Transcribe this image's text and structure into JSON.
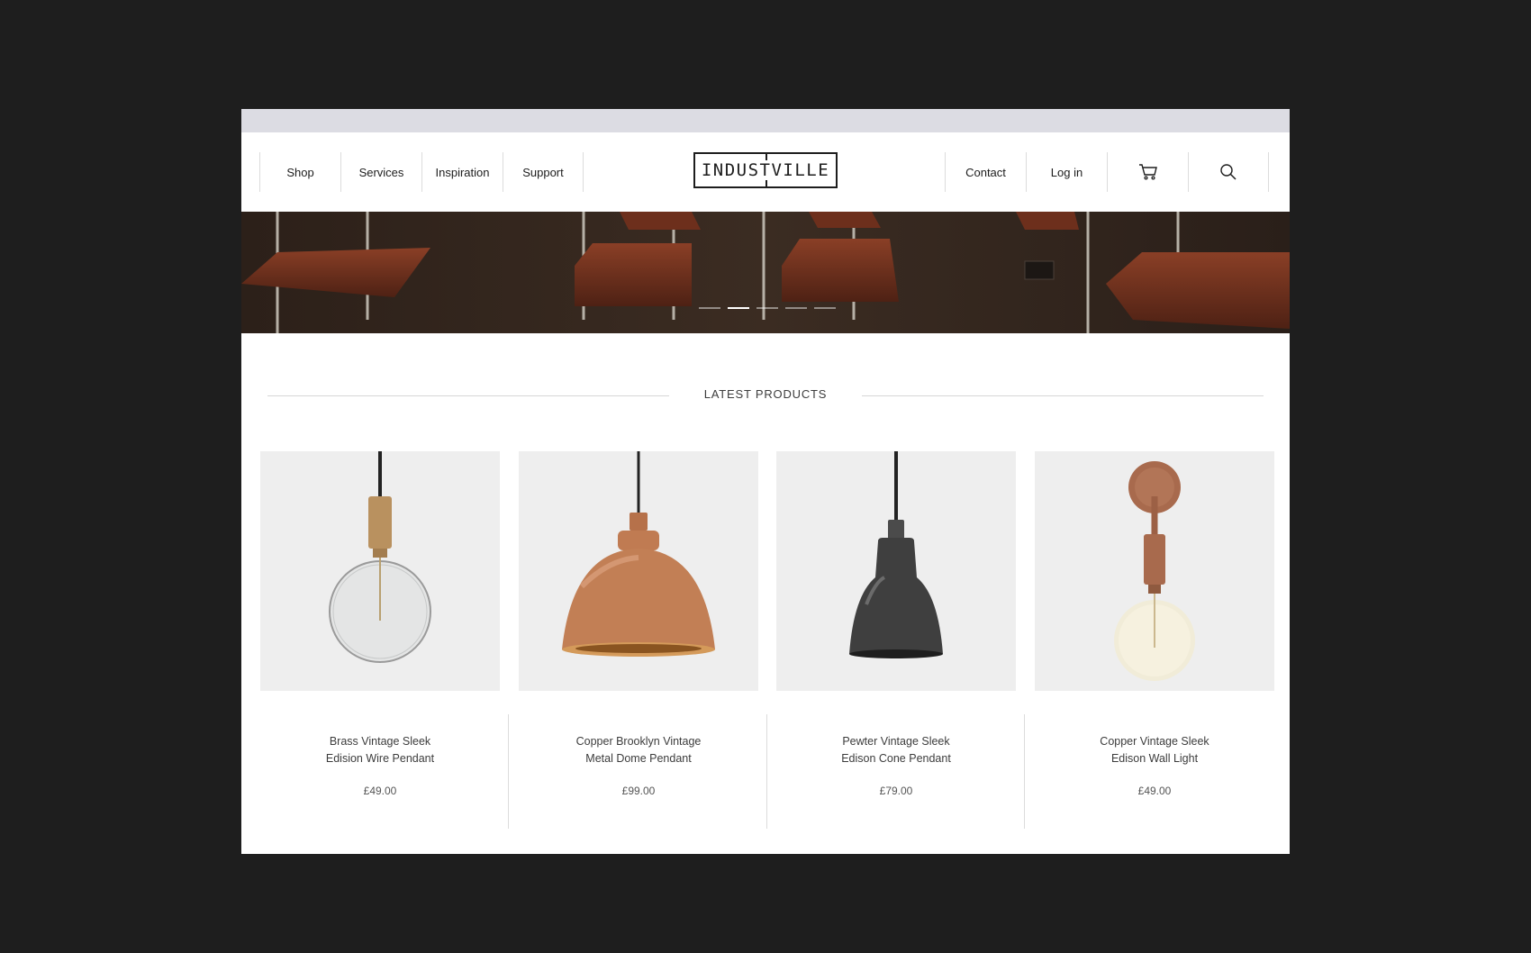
{
  "nav": {
    "left": [
      "Shop",
      "Services",
      "Inspiration",
      "Support"
    ],
    "right": [
      "Contact",
      "Log in"
    ],
    "cart_icon": "cart-icon",
    "search_icon": "search-icon"
  },
  "logo": "INDUSTVILLE",
  "hero": {
    "slides_total": 5,
    "active_slide": 2
  },
  "section_title": "LATEST PRODUCTS",
  "products": [
    {
      "name_line1": "Brass Vintage Sleek",
      "name_line2": "Edision Wire Pendant",
      "price": "£49.00"
    },
    {
      "name_line1": "Copper Brooklyn Vintage",
      "name_line2": "Metal Dome Pendant",
      "price": "£99.00"
    },
    {
      "name_line1": "Pewter Vintage Sleek",
      "name_line2": "Edison Cone Pendant",
      "price": "£79.00"
    },
    {
      "name_line1": "Copper Vintage Sleek",
      "name_line2": "Edison Wall Light",
      "price": "£49.00"
    }
  ],
  "colors": {
    "background": "#1e1e1e",
    "accent_copper": "#b87850",
    "text": "#2b2b2b"
  }
}
